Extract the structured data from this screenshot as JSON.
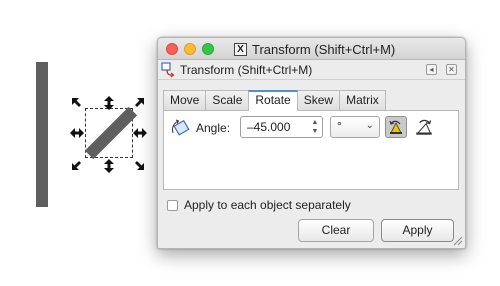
{
  "window": {
    "title": "Transform (Shift+Ctrl+M)",
    "app_icon": "x11-icon",
    "app_icon_glyph": "X"
  },
  "dock": {
    "title": "Transform (Shift+Ctrl+M)"
  },
  "tabs": [
    {
      "label": "Move",
      "active": false
    },
    {
      "label": "Scale",
      "active": false
    },
    {
      "label": "Rotate",
      "active": true
    },
    {
      "label": "Skew",
      "active": false
    },
    {
      "label": "Matrix",
      "active": false
    }
  ],
  "rotate": {
    "angle_label": "Angle:",
    "angle_value": "–45.000",
    "unit": "°",
    "direction_selected": "counterclockwise"
  },
  "apply_each": {
    "label": "Apply to each object separately",
    "checked": false
  },
  "buttons": {
    "clear": "Clear",
    "apply": "Apply"
  },
  "colors": {
    "accent_tab": "#4d8ee8",
    "shape_fill": "#5f5f5f",
    "close": "#fc5f57",
    "minimize": "#fdbc2e",
    "maximize": "#33c748"
  }
}
